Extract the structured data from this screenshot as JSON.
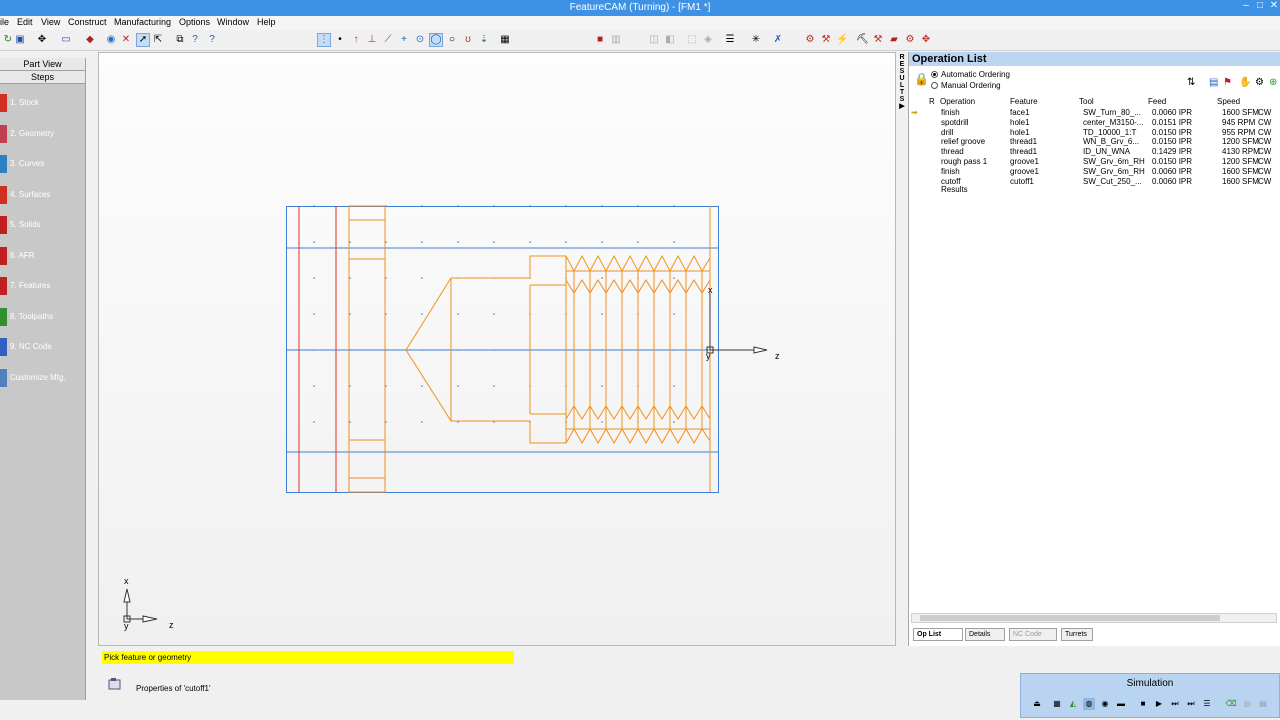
{
  "window": {
    "title": "FeatureCAM (Turning) - [FM1 *]",
    "controls": [
      "–",
      "□",
      "✕"
    ]
  },
  "menu": [
    "ile",
    "Edit",
    "View",
    "Construct",
    "Manufacturing",
    "Options",
    "Window",
    "Help"
  ],
  "left_panel": {
    "part_view_label": "Part View",
    "steps_label": "Steps",
    "steps": [
      {
        "label": "1. Stock",
        "color": "#d03020"
      },
      {
        "label": "2. Geometry",
        "color": "#c04050"
      },
      {
        "label": "3. Curves",
        "color": "#3080c0"
      },
      {
        "label": "4. Surfaces",
        "color": "#d03020"
      },
      {
        "label": "5. Solids",
        "color": "#c02020"
      },
      {
        "label": "6. AFR",
        "color": "#c02020"
      },
      {
        "label": "7. Features",
        "color": "#c02020"
      },
      {
        "label": "8. Toolpaths",
        "color": "#309030"
      },
      {
        "label": "9. NC Code",
        "color": "#3060c0"
      },
      {
        "label": "Customize Mfg.",
        "color": "#5080c0"
      }
    ]
  },
  "toolbox_label": [
    "T",
    "O",
    "O",
    "L",
    "B",
    "O",
    "X",
    "◀"
  ],
  "results_label": [
    "R",
    "E",
    "S",
    "U",
    "L",
    "T",
    "S",
    "▶"
  ],
  "viewport": {
    "axis_labels": {
      "x": "x",
      "y": "y",
      "z": "z"
    }
  },
  "op_list": {
    "title": "Operation List",
    "ordering": {
      "auto": "Automatic Ordering",
      "manual": "Manual Ordering",
      "selected": "auto"
    },
    "columns": [
      "R",
      "Operation",
      "Feature",
      "Tool",
      "Feed",
      "Speed"
    ],
    "rows": [
      {
        "op": "finish",
        "feature": "face1",
        "tool": "SW_Turn_80_...",
        "feed": "0.0060 IPR",
        "speed": "1600 SFM",
        "dir": "CW",
        "current": true
      },
      {
        "op": "spotdrill",
        "feature": "hole1",
        "tool": "center_M3150-...",
        "feed": "0.0151 IPR",
        "speed": "945 RPM",
        "dir": "CW"
      },
      {
        "op": "drill",
        "feature": "hole1",
        "tool": "TD_10000_1:T",
        "feed": "0.0150 IPR",
        "speed": "955 RPM",
        "dir": "CW"
      },
      {
        "op": "relief groove",
        "feature": "thread1",
        "tool": "WN_B_Grv_6...",
        "feed": "0.0150 IPR",
        "speed": "1200 SFM",
        "dir": "CW"
      },
      {
        "op": "thread",
        "feature": "thread1",
        "tool": "ID_UN_WNA",
        "feed": "0.1429 IPR",
        "speed": "4130 RPM",
        "dir": "CW"
      },
      {
        "op": "rough pass 1",
        "feature": "groove1",
        "tool": "SW_Grv_6m_RH",
        "feed": "0.0150 IPR",
        "speed": "1200 SFM",
        "dir": "CW"
      },
      {
        "op": "finish",
        "feature": "groove1",
        "tool": "SW_Grv_6m_RH",
        "feed": "0.0060 IPR",
        "speed": "1600 SFM",
        "dir": "CW"
      },
      {
        "op": "cutoff",
        "feature": "cutoff1",
        "tool": "SW_Cut_250_...",
        "feed": "0.0060 IPR",
        "speed": "1600 SFM",
        "dir": "CW"
      }
    ],
    "results_label": "Results",
    "tabs": [
      "Op List",
      "Details",
      "NC Code",
      "Turrets"
    ]
  },
  "status": {
    "prompt": "Pick feature or geometry",
    "properties": "Properties of 'cutoff1'"
  },
  "simulation": {
    "title": "Simulation"
  },
  "colors": {
    "titlebar": "#3e92e6",
    "geometry": "#f0901c",
    "stock": "#3b7fd6",
    "prompt_bg": "#ffff00"
  }
}
